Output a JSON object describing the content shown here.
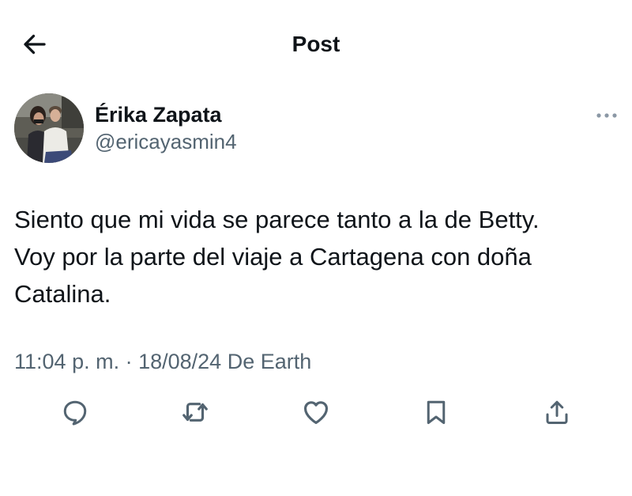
{
  "header": {
    "title": "Post",
    "back_icon": "arrow-left-icon"
  },
  "author": {
    "display_name": "Érika Zapata",
    "handle": "@ericayasmin4",
    "more_icon": "more-horizontal-icon"
  },
  "tweet": {
    "text": "Siento que mi vida se parece tanto a la de Betty.\nVoy por la parte del viaje a Cartagena con doña\nCatalina."
  },
  "meta": {
    "time": "11:04 p. m.",
    "separator": " · ",
    "date": "18/08/24",
    "source": " De Earth"
  },
  "actions": [
    {
      "name": "reply",
      "icon": "reply-icon"
    },
    {
      "name": "repost",
      "icon": "repost-icon"
    },
    {
      "name": "like",
      "icon": "heart-icon"
    },
    {
      "name": "bookmark",
      "icon": "bookmark-icon"
    },
    {
      "name": "share",
      "icon": "share-icon"
    }
  ],
  "colors": {
    "text_primary": "#0f1419",
    "text_secondary": "#536471",
    "background": "#ffffff"
  }
}
